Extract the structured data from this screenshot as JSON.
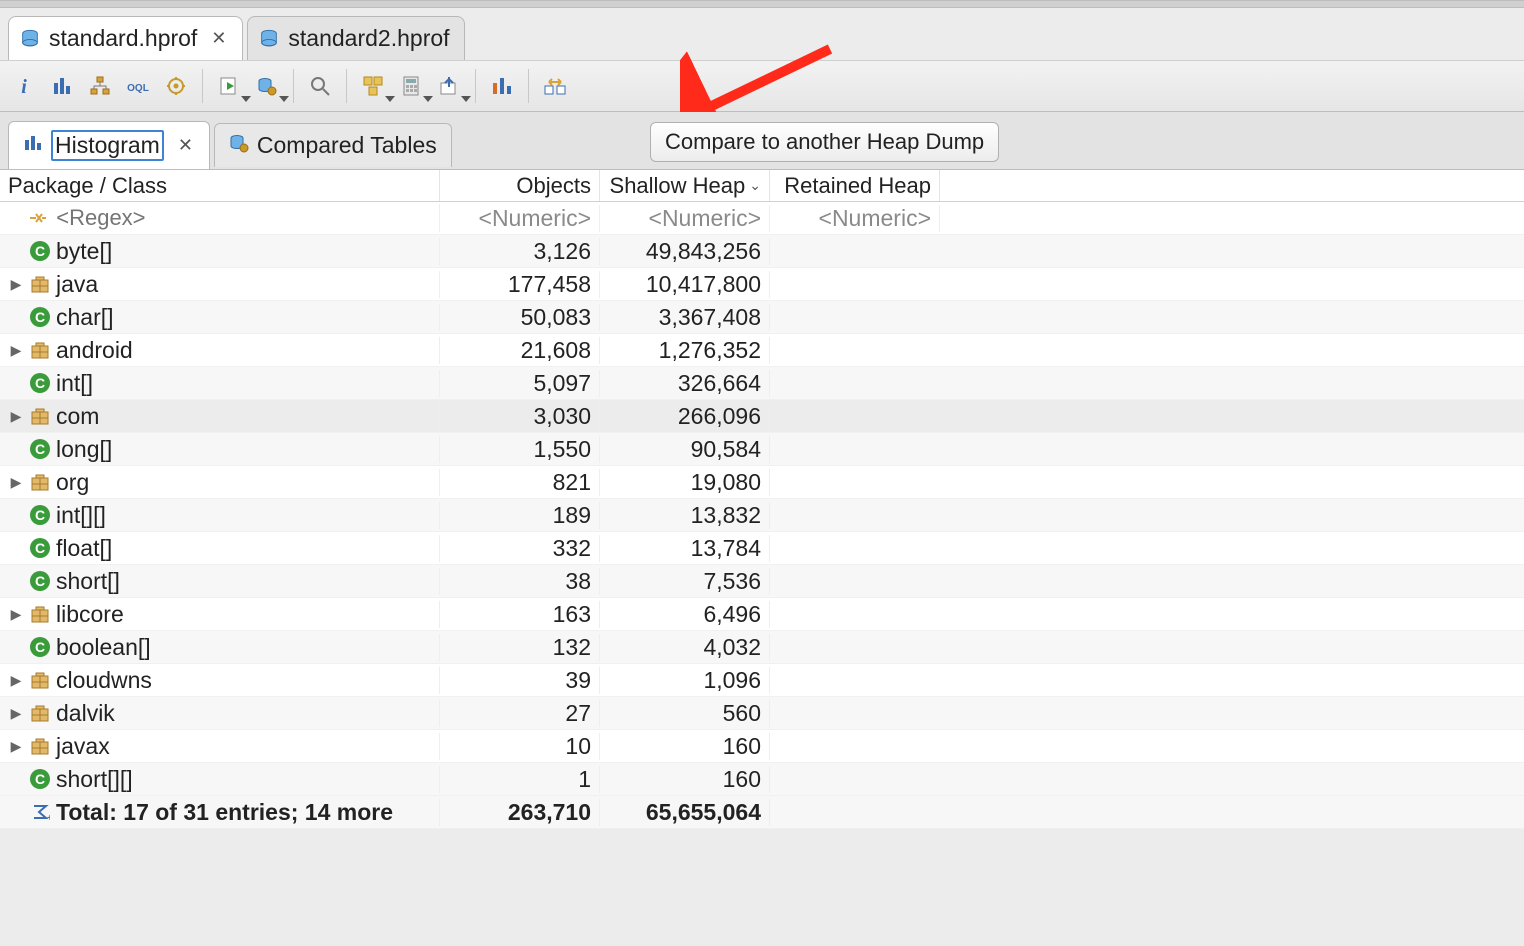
{
  "file_tabs": [
    {
      "label": "standard.hprof",
      "active": true
    },
    {
      "label": "standard2.hprof",
      "active": false
    }
  ],
  "toolbar": {
    "buttons": [
      {
        "name": "overview-icon",
        "dd": false
      },
      {
        "name": "histogram-icon",
        "dd": false
      },
      {
        "name": "dominator-tree-icon",
        "dd": false
      },
      {
        "name": "oql-icon",
        "dd": false
      },
      {
        "name": "thread-overview-icon",
        "dd": false
      },
      {
        "sep": true
      },
      {
        "name": "run-report-icon",
        "dd": true
      },
      {
        "name": "query-browser-icon",
        "dd": true
      },
      {
        "sep": true
      },
      {
        "name": "search-icon",
        "dd": false
      },
      {
        "sep": true
      },
      {
        "name": "group-icon",
        "dd": true
      },
      {
        "name": "calculator-icon",
        "dd": true
      },
      {
        "name": "export-icon",
        "dd": true
      },
      {
        "sep": true
      },
      {
        "name": "compare-basket-icon",
        "dd": false
      },
      {
        "sep": true
      },
      {
        "name": "compare-heap-dump-icon",
        "dd": false
      }
    ]
  },
  "sub_tabs": [
    {
      "label": "Histogram",
      "icon": "histogram",
      "active": true
    },
    {
      "label": "Compared Tables",
      "icon": "gear-db",
      "active": false
    }
  ],
  "compare_button_label": "Compare to another Heap Dump",
  "columns": {
    "c1": "Package / Class",
    "c2": "Objects",
    "c3": "Shallow Heap",
    "c4": "Retained Heap",
    "sort_on": "c3",
    "sort_dir": "desc"
  },
  "filter_row": {
    "regex_placeholder": "<Regex>",
    "numeric_placeholder": "<Numeric>"
  },
  "rows": [
    {
      "type": "class",
      "expand": false,
      "name": "byte[]",
      "objects": "3,126",
      "shallow": "49,843,256",
      "retained": "",
      "hover": false
    },
    {
      "type": "pkg",
      "expand": true,
      "name": "java",
      "objects": "177,458",
      "shallow": "10,417,800",
      "retained": "",
      "hover": false
    },
    {
      "type": "class",
      "expand": false,
      "name": "char[]",
      "objects": "50,083",
      "shallow": "3,367,408",
      "retained": "",
      "hover": false
    },
    {
      "type": "pkg",
      "expand": true,
      "name": "android",
      "objects": "21,608",
      "shallow": "1,276,352",
      "retained": "",
      "hover": false
    },
    {
      "type": "class",
      "expand": false,
      "name": "int[]",
      "objects": "5,097",
      "shallow": "326,664",
      "retained": "",
      "hover": false
    },
    {
      "type": "pkg",
      "expand": true,
      "name": "com",
      "objects": "3,030",
      "shallow": "266,096",
      "retained": "",
      "hover": true
    },
    {
      "type": "class",
      "expand": false,
      "name": "long[]",
      "objects": "1,550",
      "shallow": "90,584",
      "retained": "",
      "hover": false
    },
    {
      "type": "pkg",
      "expand": true,
      "name": "org",
      "objects": "821",
      "shallow": "19,080",
      "retained": "",
      "hover": false
    },
    {
      "type": "class",
      "expand": false,
      "name": "int[][]",
      "objects": "189",
      "shallow": "13,832",
      "retained": "",
      "hover": false
    },
    {
      "type": "class",
      "expand": false,
      "name": "float[]",
      "objects": "332",
      "shallow": "13,784",
      "retained": "",
      "hover": false
    },
    {
      "type": "class",
      "expand": false,
      "name": "short[]",
      "objects": "38",
      "shallow": "7,536",
      "retained": "",
      "hover": false
    },
    {
      "type": "pkg",
      "expand": true,
      "name": "libcore",
      "objects": "163",
      "shallow": "6,496",
      "retained": "",
      "hover": false
    },
    {
      "type": "class",
      "expand": false,
      "name": "boolean[]",
      "objects": "132",
      "shallow": "4,032",
      "retained": "",
      "hover": false
    },
    {
      "type": "pkg",
      "expand": true,
      "name": "cloudwns",
      "objects": "39",
      "shallow": "1,096",
      "retained": "",
      "hover": false
    },
    {
      "type": "pkg",
      "expand": true,
      "name": "dalvik",
      "objects": "27",
      "shallow": "560",
      "retained": "",
      "hover": false
    },
    {
      "type": "pkg",
      "expand": true,
      "name": "javax",
      "objects": "10",
      "shallow": "160",
      "retained": "",
      "hover": false
    },
    {
      "type": "class",
      "expand": false,
      "name": "short[][]",
      "objects": "1",
      "shallow": "160",
      "retained": "",
      "hover": false
    }
  ],
  "total_row": {
    "label": "Total: 17 of 31 entries; 14 more",
    "objects": "263,710",
    "shallow": "65,655,064",
    "retained": ""
  }
}
